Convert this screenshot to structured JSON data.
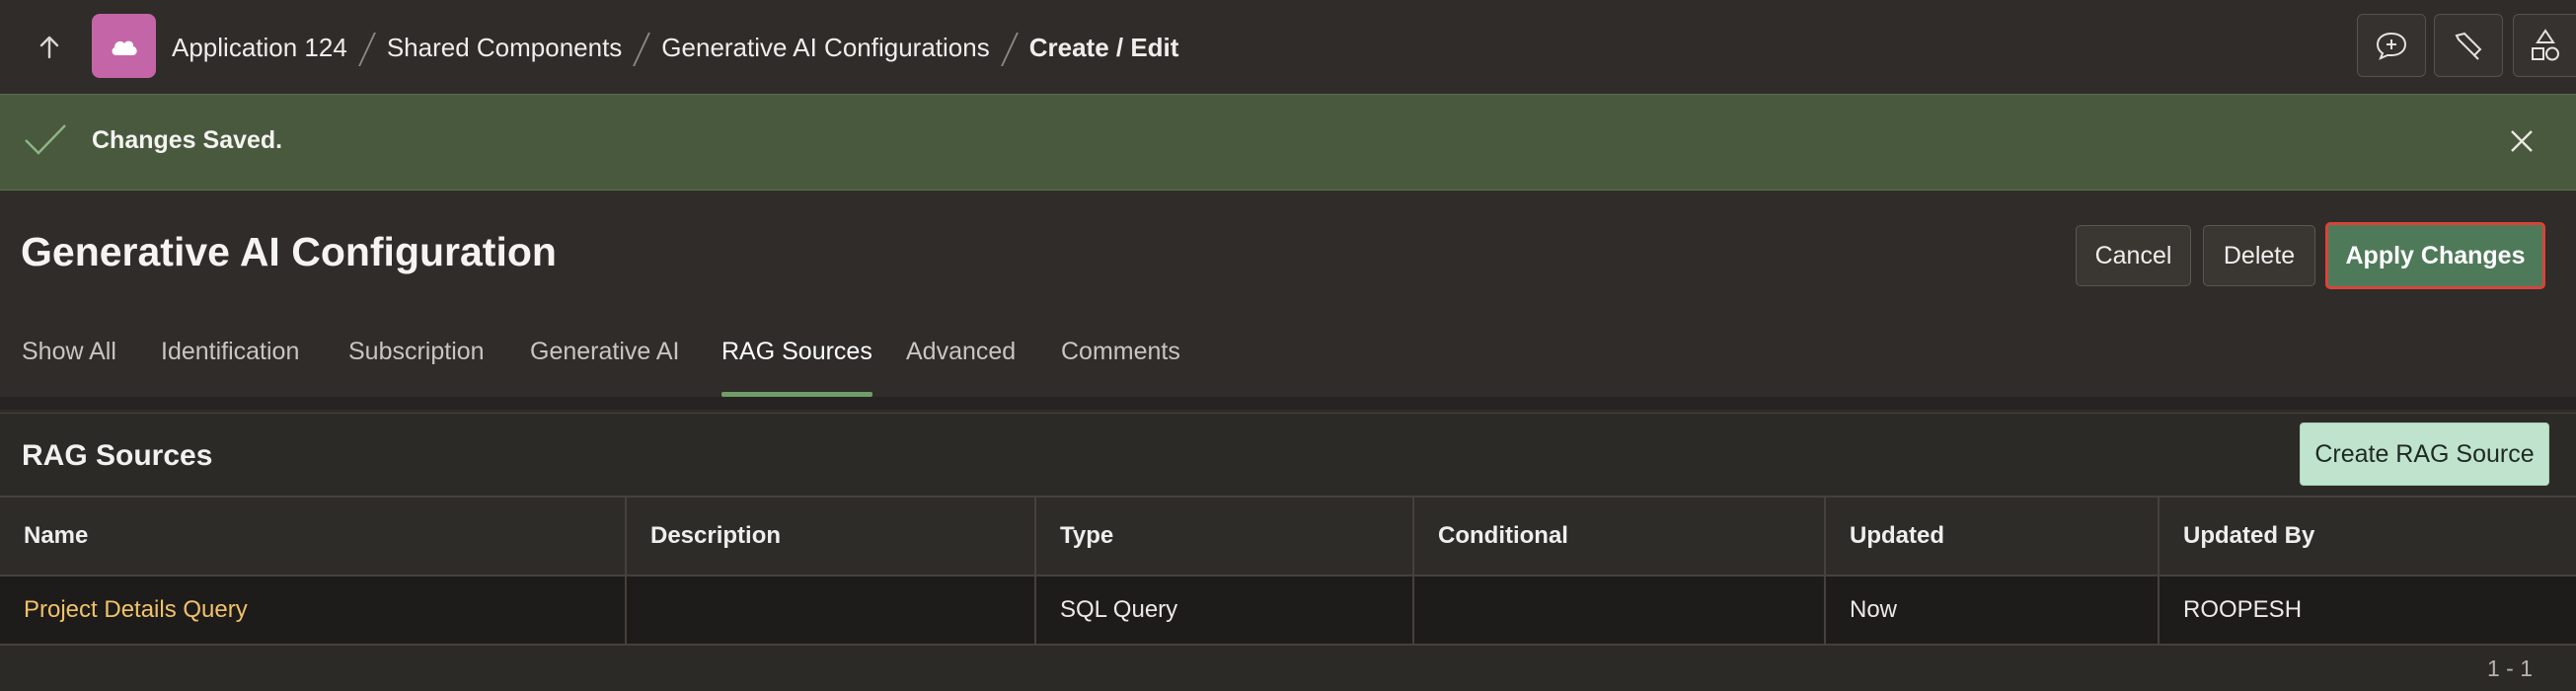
{
  "breadcrumb": {
    "items": [
      "Application 124",
      "Shared Components",
      "Generative AI Configurations"
    ],
    "current": "Create / Edit"
  },
  "topbar_icons": [
    "feedback-icon",
    "developer-toolbar-icon",
    "shared-components-icon"
  ],
  "banner": {
    "message": "Changes Saved.",
    "status_color": "#49593e"
  },
  "page": {
    "title": "Generative AI Configuration",
    "buttons": {
      "cancel": "Cancel",
      "delete": "Delete",
      "apply": "Apply Changes"
    }
  },
  "tabs": {
    "items": [
      "Show All",
      "Identification",
      "Subscription",
      "Generative AI",
      "RAG Sources",
      "Advanced",
      "Comments"
    ],
    "active": "RAG Sources"
  },
  "rag_region": {
    "title": "RAG Sources",
    "create_button": "Create RAG Source",
    "columns": [
      "Name",
      "Description",
      "Type",
      "Conditional",
      "Updated",
      "Updated By"
    ],
    "rows": [
      {
        "name": "Project Details Query",
        "description": "",
        "type": "SQL Query",
        "conditional": "",
        "updated": "Now",
        "updated_by": "ROOPESH"
      }
    ],
    "pagination": "1 - 1"
  },
  "colors": {
    "accent_green": "#4f7a5a",
    "link": "#f0c26a",
    "app_icon": "#c465a8",
    "highlight_border": "#d9433b"
  }
}
